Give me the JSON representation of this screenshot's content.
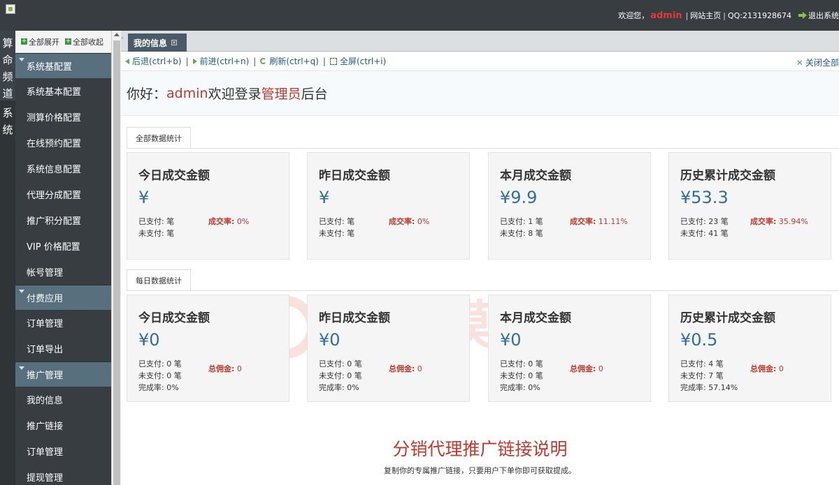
{
  "topbar": {
    "welcome": "欢迎您，",
    "username": "admin",
    "site_home": "网站主页",
    "qq": "QQ:2131928674",
    "logout": "退出系统"
  },
  "channels": [
    "算命频道",
    "系统"
  ],
  "sidebar": {
    "expand_all": "全部展开",
    "collapse_all": "全部收起",
    "groups": [
      {
        "title": "系统基配置",
        "items": [
          "系统基本配置",
          "测算价格配置",
          "在线预约配置",
          "系统信息配置",
          "代理分成配置",
          "推广积分配置",
          "VIP 价格配置",
          "帐号管理"
        ]
      },
      {
        "title": "付费应用",
        "items": [
          "订单管理",
          "订单导出"
        ]
      },
      {
        "title": "推广管理",
        "items": [
          "我的信息",
          "推广链接",
          "订单管理",
          "提现管理"
        ]
      }
    ]
  },
  "tabs": [
    {
      "label": "我的信息"
    }
  ],
  "toolbar": {
    "back": "后退(ctrl+b)",
    "forward": "前进(ctrl+n)",
    "refresh": "刷新(ctrl+q)",
    "fullscreen": "全屏(ctrl+i)",
    "close_all": "关闭全部"
  },
  "welcome": {
    "prefix": "你好：",
    "user": "admin",
    "middle": "欢迎登录",
    "role": "管理员",
    "suffix": "后台"
  },
  "all_stats": {
    "tab_label": "全部数据统计",
    "cards": [
      {
        "title": "今日成交金额",
        "amount": "¥",
        "paid": "已支付: 笔",
        "unpaid": "未支付: 笔",
        "ratio_label": "成交率:",
        "ratio_value": " 0%"
      },
      {
        "title": "昨日成交金额",
        "amount": "¥",
        "paid": "已支付: 笔",
        "unpaid": "未支付: 笔",
        "ratio_label": "成交率:",
        "ratio_value": " 0%"
      },
      {
        "title": "本月成交金额",
        "amount": "¥9.9",
        "paid": "已支付: 1 笔",
        "unpaid": "未支付: 8 笔",
        "ratio_label": "成交率:",
        "ratio_value": " 11.11%"
      },
      {
        "title": "历史累计成交金额",
        "amount": "¥53.3",
        "paid": "已支付: 23 笔",
        "unpaid": "未支付: 41 笔",
        "ratio_label": "成交率:",
        "ratio_value": " 35.94%"
      }
    ]
  },
  "daily_stats": {
    "tab_label": "每日数据统计",
    "cards": [
      {
        "title": "今日成交金额",
        "amount": "¥0",
        "paid": "已支付: 0 笔",
        "unpaid": "未支付: 0 笔",
        "completion": "完成率: 0%",
        "commission_label": "总佣金:",
        "commission_value": " 0"
      },
      {
        "title": "昨日成交金额",
        "amount": "¥0",
        "paid": "已支付: 0 笔",
        "unpaid": "未支付: 0 笔",
        "completion": "完成率: 0%",
        "commission_label": "总佣金:",
        "commission_value": " 0"
      },
      {
        "title": "本月成交金额",
        "amount": "¥0",
        "paid": "已支付: 0 笔",
        "unpaid": "未支付: 0 笔",
        "completion": "完成率: 0%",
        "commission_label": "总佣金:",
        "commission_value": " 0"
      },
      {
        "title": "历史累计成交金额",
        "amount": "¥0.5",
        "paid": "已支付: 4 笔",
        "unpaid": "未支付: 7 笔",
        "completion": "完成率: 57.14%",
        "commission_label": "总佣金:",
        "commission_value": " 0"
      }
    ]
  },
  "explain": {
    "title": "分销代理推广链接说明",
    "subtitle": "复制你的专属推广链接，只要用户下单你即可获取提成。"
  },
  "watermark": "一淘模板"
}
